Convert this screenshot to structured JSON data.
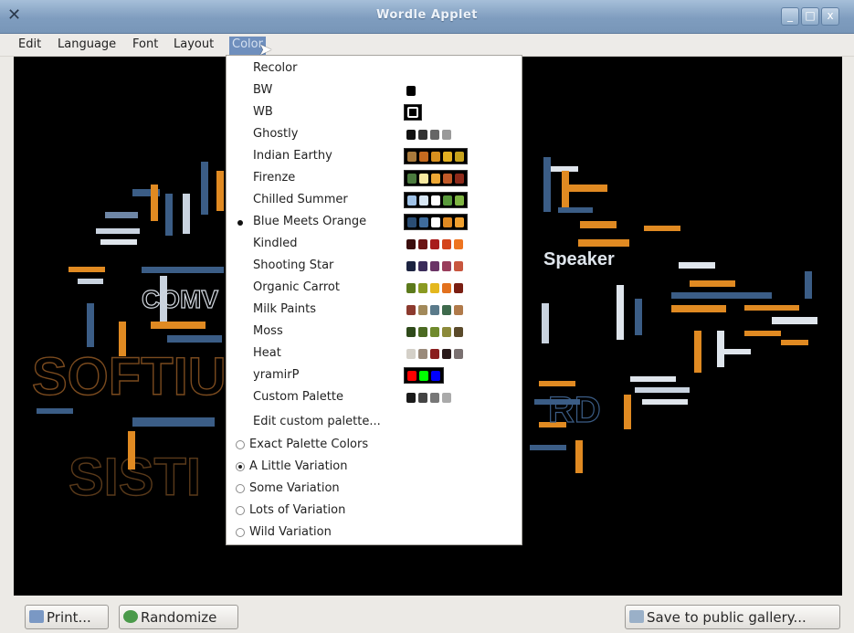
{
  "window": {
    "title": "Wordle Applet",
    "buttons": [
      "_",
      "□",
      "x"
    ]
  },
  "menubar": [
    "Edit",
    "Language",
    "Font",
    "Layout",
    "Color"
  ],
  "active_menu": "Color",
  "color_menu": {
    "recolor": "Recolor",
    "palettes": [
      {
        "label": "BW",
        "selected": false,
        "framed": false,
        "colors": [
          "#000000"
        ]
      },
      {
        "label": "WB",
        "selected": false,
        "framed": true,
        "colors": [
          "#ffffff"
        ]
      },
      {
        "label": "Ghostly",
        "selected": false,
        "framed": false,
        "colors": [
          "#111111",
          "#333333",
          "#666666",
          "#999999"
        ]
      },
      {
        "label": "Indian Earthy",
        "selected": false,
        "framed": true,
        "colors": [
          "#a97a3c",
          "#c46a1f",
          "#d8901e",
          "#e3b021",
          "#c7a21b"
        ]
      },
      {
        "label": "Firenze",
        "selected": false,
        "framed": true,
        "colors": [
          "#4b7b3e",
          "#f7e9a0",
          "#eda734",
          "#c15a28",
          "#8e2a1a"
        ]
      },
      {
        "label": "Chilled Summer",
        "selected": false,
        "framed": true,
        "colors": [
          "#9fc2e7",
          "#d7e6f4",
          "#ffffff",
          "#5a9a3c",
          "#7fb542"
        ]
      },
      {
        "label": "Blue Meets Orange",
        "selected": true,
        "framed": true,
        "colors": [
          "#2a4d74",
          "#3f6c9c",
          "#ffffff",
          "#e08a22",
          "#f0a02f"
        ]
      },
      {
        "label": "Kindled",
        "selected": false,
        "framed": false,
        "colors": [
          "#3b0e0e",
          "#6b1414",
          "#a81c1c",
          "#d4451c",
          "#ee7420"
        ]
      },
      {
        "label": "Shooting Star",
        "selected": false,
        "framed": false,
        "colors": [
          "#1c2340",
          "#3b2c5a",
          "#6a3466",
          "#9a3e5c",
          "#c8563e"
        ]
      },
      {
        "label": "Organic Carrot",
        "selected": false,
        "framed": false,
        "colors": [
          "#5c7a1c",
          "#8a9a22",
          "#e4b71e",
          "#e2711e",
          "#7a1e12"
        ]
      },
      {
        "label": "Milk Paints",
        "selected": false,
        "framed": false,
        "colors": [
          "#8c3a2e",
          "#a2895a",
          "#5a7a8a",
          "#3e6a4c",
          "#b07a4a"
        ]
      },
      {
        "label": "Moss",
        "selected": false,
        "framed": false,
        "colors": [
          "#2e4a1a",
          "#4b6a22",
          "#6f8a2c",
          "#8c8a3a",
          "#5a4a2a"
        ]
      },
      {
        "label": "Heat",
        "selected": false,
        "framed": false,
        "colors": [
          "#d4d0c8",
          "#9a8a7a",
          "#8a1e1e",
          "#2a1a1a",
          "#7a7070"
        ]
      },
      {
        "label": "yramirP",
        "selected": false,
        "framed": true,
        "colors": [
          "#ff0000",
          "#00ff00",
          "#0000ff"
        ]
      },
      {
        "label": "Custom Palette",
        "selected": false,
        "framed": false,
        "colors": [
          "#1a1a1a",
          "#444444",
          "#777777",
          "#aaaaaa"
        ]
      }
    ],
    "edit_custom": "Edit custom palette...",
    "variations": [
      {
        "label": "Exact Palette Colors",
        "checked": false
      },
      {
        "label": "A Little Variation",
        "checked": true
      },
      {
        "label": "Some Variation",
        "checked": false
      },
      {
        "label": "Lots of Variation",
        "checked": false
      },
      {
        "label": "Wild Variation",
        "checked": false
      }
    ]
  },
  "bottom": {
    "print": "Print...",
    "randomize": "Randomize",
    "save": "Save to public gallery..."
  },
  "colors": {
    "titlebar": "#7f9dbf",
    "menu_highlight": "#6f8fbd",
    "canvas": "#000000"
  }
}
